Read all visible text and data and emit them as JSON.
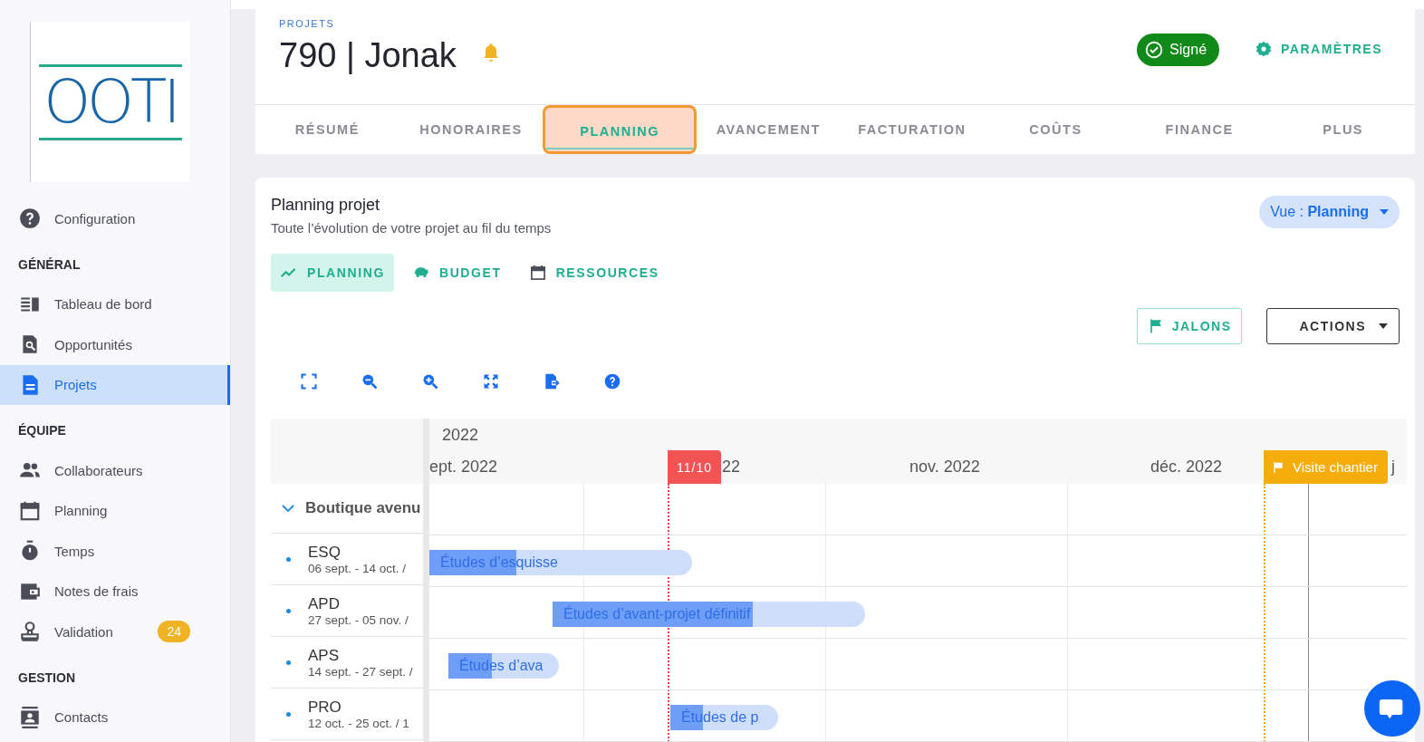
{
  "sidebar": {
    "logo": "OOTI",
    "sections": [
      {
        "items": [
          {
            "label": "Configuration",
            "selected": false
          }
        ]
      },
      {
        "title": "GÉNÉRAL",
        "items": [
          {
            "label": "Tableau de bord",
            "selected": false
          },
          {
            "label": "Opportunités",
            "selected": false
          },
          {
            "label": "Projets",
            "selected": true
          }
        ]
      },
      {
        "title": "ÉQUIPE",
        "items": [
          {
            "label": "Collaborateurs",
            "selected": false
          },
          {
            "label": "Planning",
            "selected": false
          },
          {
            "label": "Temps",
            "selected": false
          },
          {
            "label": "Notes de frais",
            "selected": false
          },
          {
            "label": "Validation",
            "selected": false,
            "badge": "24"
          }
        ]
      },
      {
        "title": "GESTION",
        "items": [
          {
            "label": "Contacts",
            "selected": false
          }
        ]
      }
    ]
  },
  "header": {
    "breadcrumb": "PROJETS",
    "title": "790 | Jonak",
    "status": "Signé",
    "settings": "PARAMÈTRES"
  },
  "tabs": [
    {
      "label": "RÉSUMÉ",
      "selected": false
    },
    {
      "label": "HONORAIRES",
      "selected": false
    },
    {
      "label": "PLANNING",
      "selected": true
    },
    {
      "label": "AVANCEMENT",
      "selected": false
    },
    {
      "label": "FACTURATION",
      "selected": false
    },
    {
      "label": "COÛTS",
      "selected": false
    },
    {
      "label": "FINANCE",
      "selected": false
    },
    {
      "label": "PLUS",
      "selected": false
    }
  ],
  "panel": {
    "title": "Planning projet",
    "subtitle": "Toute l’évolution de votre projet au fil du temps",
    "view_label": "Vue : ",
    "view_value": "Planning",
    "subtabs": [
      {
        "label": "PLANNING",
        "selected": true
      },
      {
        "label": "BUDGET",
        "selected": false
      },
      {
        "label": "RESSOURCES",
        "selected": false
      }
    ],
    "jalons": "JALONS",
    "actions": "ACTIONS"
  },
  "gantt": {
    "year": "2022",
    "months": [
      "ept. 2022",
      "22",
      "nov. 2022",
      "déc. 2022",
      "j"
    ],
    "today": "11/10",
    "milestone": "Visite chantier",
    "group": {
      "label": "Boutique avenu",
      "expanded": true
    },
    "rows": [
      {
        "code": "ESQ",
        "dates": "06 sept. - 14 oct. /",
        "bar": "Études d’esquisse",
        "level": 0.33
      },
      {
        "code": "APD",
        "dates": "27 sept. - 05 nov. /",
        "bar": "Études d’avant-projet définitif",
        "level": 0.64
      },
      {
        "code": "APS",
        "dates": "14 sept. - 27 sept. /",
        "bar": "Études d’ava",
        "level": 0.39
      },
      {
        "code": "PRO",
        "dates": "12 oct. - 25 oct. / 1",
        "bar": "Études de p",
        "level": 0.3
      }
    ]
  }
}
